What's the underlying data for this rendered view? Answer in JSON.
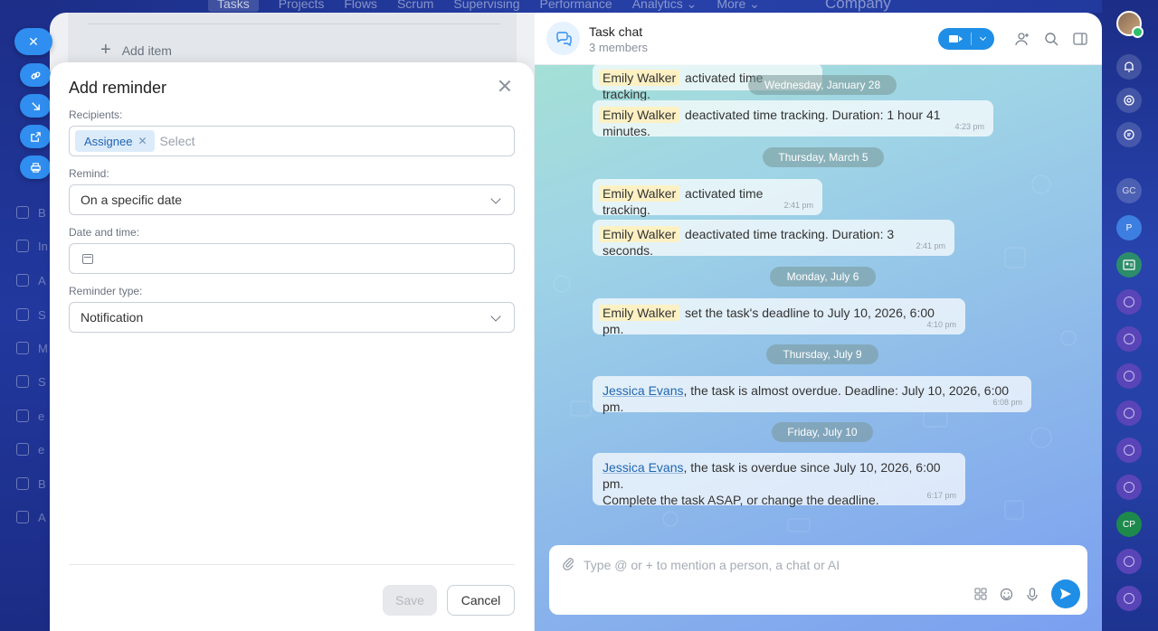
{
  "background": {
    "nav_tabs": [
      "Tasks",
      "Projects",
      "Flows",
      "Scrum",
      "Supervising",
      "Performance",
      "Analytics ⌄",
      "More ⌄"
    ],
    "company": "Company",
    "add_item": "Add item",
    "left_items": [
      "B",
      "In",
      "A",
      "S",
      "M",
      "S",
      "e",
      "e",
      "B",
      "A"
    ]
  },
  "dialog": {
    "title": "Add reminder",
    "recipients_label": "Recipients:",
    "recipient_chip": "Assignee",
    "recipients_placeholder": "Select",
    "remind_label": "Remind:",
    "remind_value": "On a specific date",
    "datetime_label": "Date and time:",
    "datetime_value": "",
    "type_label": "Reminder type:",
    "type_value": "Notification",
    "save_label": "Save",
    "cancel_label": "Cancel"
  },
  "chat": {
    "title": "Task chat",
    "subtitle": "3 members",
    "composer_placeholder": "Type @ or + to mention a person, a chat or AI",
    "dates": {
      "d1": "Wednesday, January 28",
      "d2": "Thursday, March 5",
      "d3": "Monday, July 6",
      "d4": "Thursday, July 9",
      "d5": "Friday, July 10"
    },
    "messages": [
      {
        "name": "Emily Walker",
        "text": "activated time tracking.",
        "time": ""
      },
      {
        "name": "Emily Walker",
        "text": "deactivated time tracking. Duration: 1 hour 41 minutes.",
        "time": "4:23 pm"
      },
      {
        "name": "Emily Walker",
        "text": "activated time tracking.",
        "time": "2:41 pm"
      },
      {
        "name": "Emily Walker",
        "text": "deactivated time tracking. Duration: 3 seconds.",
        "time": "2:41 pm"
      },
      {
        "name": "Emily Walker",
        "text": "set the task's deadline to July 10, 2026, 6:00 pm.",
        "time": "4:10 pm"
      },
      {
        "name": "Jessica Evans",
        "text": ", the task is almost overdue. Deadline: July 10, 2026, 6:00 pm.",
        "time": "6:08 pm"
      },
      {
        "name": "Jessica Evans",
        "text": ", the task is overdue since July 10, 2026, 6:00 pm.",
        "text2": "Complete the task ASAP, or change the deadline.",
        "time": "6:17 pm"
      }
    ]
  },
  "rail": {
    "gc": "GC",
    "p": "P",
    "cp": "CP"
  },
  "colors": {
    "accent": "#1f8ee6",
    "link": "#2067b0",
    "name_highlight": "#fdf1c4"
  }
}
